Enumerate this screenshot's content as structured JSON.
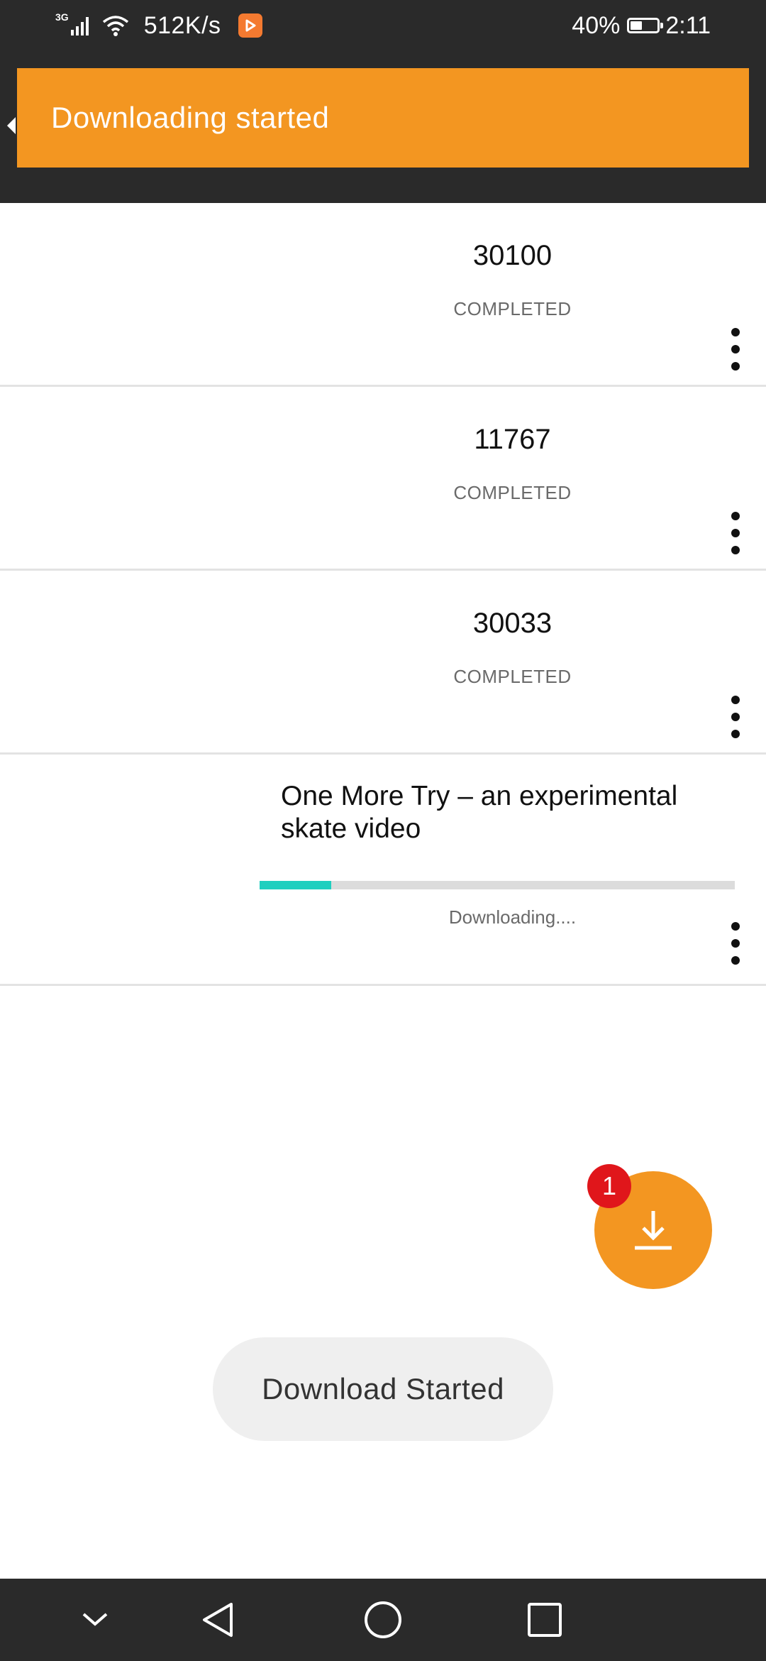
{
  "status_bar": {
    "network_type": "3G",
    "speed": "512K/s",
    "battery": "40%",
    "time": "2:11",
    "icons": [
      "signal-icon",
      "wifi-icon",
      "app-notification-icon",
      "battery-icon"
    ]
  },
  "snackbar": {
    "message": "Downloading started"
  },
  "downloads": [
    {
      "title": "30100",
      "status": "COMPLETED"
    },
    {
      "title": "11767",
      "status": "COMPLETED"
    },
    {
      "title": "30033",
      "status": "COMPLETED"
    }
  ],
  "active_download": {
    "title": "One More Try – an experimental skate video",
    "status": "Downloading....",
    "progress_fraction": 0.15
  },
  "fab": {
    "icon": "download-icon",
    "badge_count": "1"
  },
  "toast": {
    "message": "Download Started"
  },
  "nav_bar": {
    "icons": [
      "chevron-down-icon",
      "back-icon",
      "home-icon",
      "recents-icon"
    ]
  },
  "colors": {
    "accent": "#f39621",
    "progress": "#1fcfbf",
    "badge": "#e0161b",
    "dark_bar": "#2a2a2a"
  }
}
